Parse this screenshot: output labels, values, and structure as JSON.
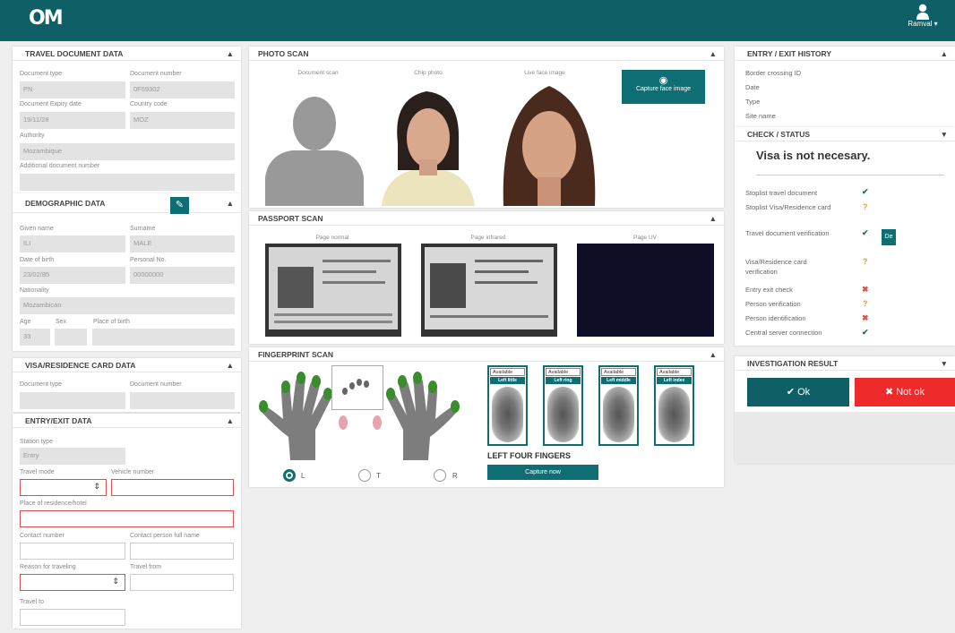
{
  "header": {
    "logo": "OM",
    "user_label": "Ramval ▾"
  },
  "travel_doc": {
    "title": "TRAVEL DOCUMENT DATA",
    "document_type_label": "Document type",
    "document_type_value": "PN",
    "document_number_label": "Document number",
    "document_number_value": "0F59302",
    "expiry_label": "Document Expiry date",
    "expiry_value": "19/11/28",
    "country_label": "Country code",
    "country_value": "MOZ",
    "authority_label": "Authority",
    "authority_value": "Mozambique",
    "additional_label": "Additional document number"
  },
  "demographic": {
    "title": "DEMOGRAPHIC DATA",
    "given_label": "Given name",
    "given_value": "ILI",
    "surname_label": "Surname",
    "surname_value": "MALE",
    "dob_label": "Date of birth",
    "dob_value": "23/02/85",
    "personal_label": "Personal No.",
    "personal_value": "00000000",
    "nationality_label": "Nationality",
    "nationality_value": "Mozambican",
    "age_label": "Age",
    "age_value": "33",
    "sex_label": "Sex",
    "pob_label": "Place of birth"
  },
  "visa": {
    "title": "VISA/RESIDENCE CARD DATA",
    "doc_type_label": "Document type",
    "doc_number_label": "Document number"
  },
  "entry_exit": {
    "title": "ENTRY/EXIT DATA",
    "station_label": "Station type",
    "station_value": "Entry",
    "travel_mode_label": "Travel mode",
    "travel_mode_value": "⇕",
    "vehicle_label": "Vehicle number",
    "place_label": "Place of residence/hotel",
    "contact_label": "Contact number",
    "contact_person_label": "Contact person full name",
    "reason_label": "Reason for traveling",
    "reason_value": "⇕",
    "travel_from_label": "Travel from",
    "travel_to_label": "Travel to"
  },
  "photo_scan": {
    "title": "PHOTO SCAN",
    "doc_scan": "Document scan",
    "chip_photo": "Chip photo",
    "live_image": "Live face image",
    "capture_btn": "Capture face image"
  },
  "passport_scan": {
    "title": "PASSPORT SCAN",
    "page_normal": "Page normal",
    "page_infrared": "Page infrared",
    "page_uv": "Page UV"
  },
  "fingerprint": {
    "title": "FINGERPRINT SCAN",
    "radio_l": "L",
    "radio_t": "T",
    "radio_r": "R",
    "cards": [
      {
        "select": "Available",
        "label": "Left little"
      },
      {
        "select": "Available",
        "label": "Left ring"
      },
      {
        "select": "Available",
        "label": "Left middle"
      },
      {
        "select": "Available",
        "label": "Left index"
      }
    ],
    "group_label": "LEFT FOUR FINGERS",
    "capture_btn": "Capture now"
  },
  "history": {
    "title": "ENTRY / EXIT HISTORY",
    "items": [
      "Border crossing ID",
      "Date",
      "Type",
      "Site name"
    ]
  },
  "check": {
    "title": "CHECK / STATUS",
    "message": "Visa is not necesary.",
    "rows": [
      {
        "label": "Stoplist travel document",
        "mark": "✔"
      },
      {
        "label": "Stoplist Visa/Residence card",
        "mark": "?"
      },
      {
        "label": "Travel document verification",
        "mark": "✔"
      },
      {
        "label": "Visa/Residence card verification",
        "mark": "?"
      },
      {
        "label": "Entry exit check",
        "mark": "✖"
      },
      {
        "label": "Person verification",
        "mark": "?"
      },
      {
        "label": "Person identification",
        "mark": "✖"
      },
      {
        "label": "Central server connection",
        "mark": "✔"
      }
    ],
    "detail_btn": "De"
  },
  "investigation": {
    "title": "INVESTIGATION RESULT",
    "ok_btn": "✔ Ok",
    "not_ok_btn": "✖ Not ok"
  }
}
